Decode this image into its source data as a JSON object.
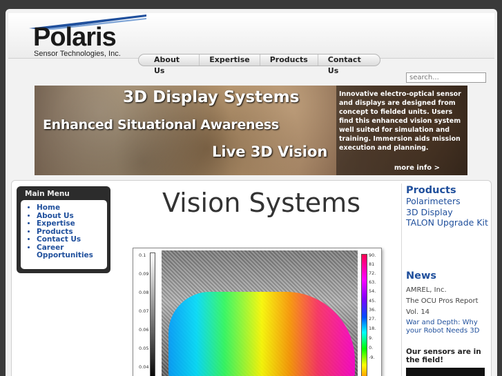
{
  "header": {
    "logo_title": "Polaris",
    "logo_subtitle": "Sensor Technologies, Inc."
  },
  "nav": {
    "items": [
      "About Us",
      "Expertise",
      "Products",
      "Contact Us"
    ]
  },
  "search": {
    "placeholder": "search..."
  },
  "banner": {
    "headline": "3D Display Systems",
    "line2": "Enhanced Situational Awareness",
    "line3": "Live 3D Vision",
    "description": "Innovative electro-optical sensor and displays are designed from concept to fielded units. Users find this enhanced vision system well suited for simulation and training. Immersion aids mission execution and planning.",
    "more_link": "more info >"
  },
  "main_menu": {
    "title": "Main Menu",
    "items": [
      "Home",
      "About Us",
      "Expertise",
      "Products",
      "Contact Us",
      "Career Opportunities"
    ]
  },
  "page_title": "Vision Systems",
  "figure": {
    "gray_scale_ticks": [
      "0.1",
      "0.09",
      "0.08",
      "0.07",
      "0.06",
      "0.05",
      "0.04"
    ],
    "color_scale_ticks": [
      "90.",
      "81",
      "72.",
      "63.",
      "54.",
      "45.",
      "36.",
      "27.",
      "18.",
      "9.",
      "0.",
      "-9."
    ]
  },
  "sidebar": {
    "products_heading": "Products",
    "products": [
      "Polarimeters",
      "3D Display",
      "TALON Upgrade Kit"
    ],
    "news_heading": "News",
    "news_item1_line1": "AMREL, Inc.",
    "news_item1_line2": "The OCU Pros Report",
    "news_item1_line3": "Vol. 14",
    "news_link": "War and Depth:  Why your Robot Needs 3D",
    "sensors_text": "Our sensors are in the field!"
  },
  "colors": {
    "link_blue": "#1f4f9c",
    "page_bg": "#3a3a3a"
  }
}
